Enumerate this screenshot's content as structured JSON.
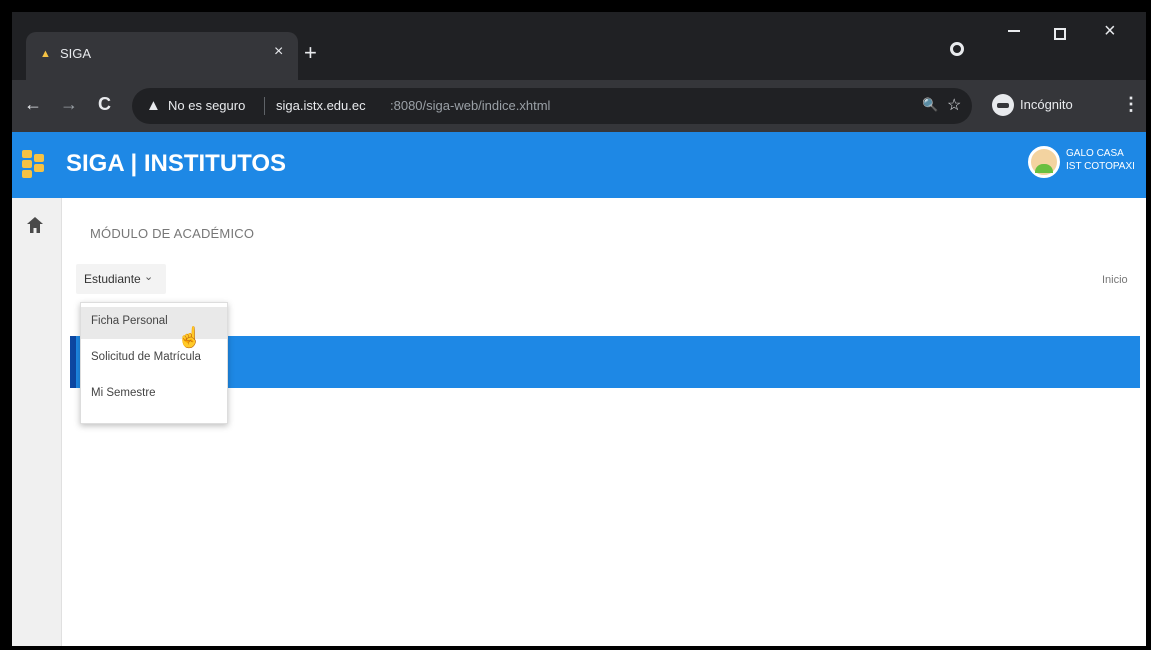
{
  "browser": {
    "tab": {
      "title": "SIGA",
      "close_icon": "×"
    },
    "new_tab_icon": "+",
    "window_controls": {
      "minimize": "minimize-icon",
      "maximize": "maximize-icon",
      "close": "×"
    },
    "nav": {
      "back": "←",
      "forward": "→",
      "reload": "C"
    },
    "omnibox": {
      "security_icon": "▲",
      "security_label": "No es seguro",
      "url_host": "siga.istx.edu.ec",
      "url_path": ":8080/siga-web/indice.xhtml"
    },
    "zoom_icon": "🔍",
    "star_icon": "☆",
    "incognito_label": "Incógnito",
    "menu_icon": "⋮"
  },
  "app": {
    "title": "SIGA | INSTITUTOS",
    "brand_color": "#1e88e5",
    "user": {
      "name": "GALO CASA",
      "institution": "IST COTOPAXI"
    }
  },
  "sidebar": {
    "home_icon": "🏠"
  },
  "content": {
    "module_title": "MÓDULO DE ACADÉMICO",
    "menu": {
      "label": "Estudiante",
      "chevron": "⌄",
      "items": [
        {
          "label": "Ficha Personal"
        },
        {
          "label": "Solicitud de Matrícula"
        },
        {
          "label": "Mi Semestre"
        }
      ]
    },
    "breadcrumb": "Inicio"
  }
}
